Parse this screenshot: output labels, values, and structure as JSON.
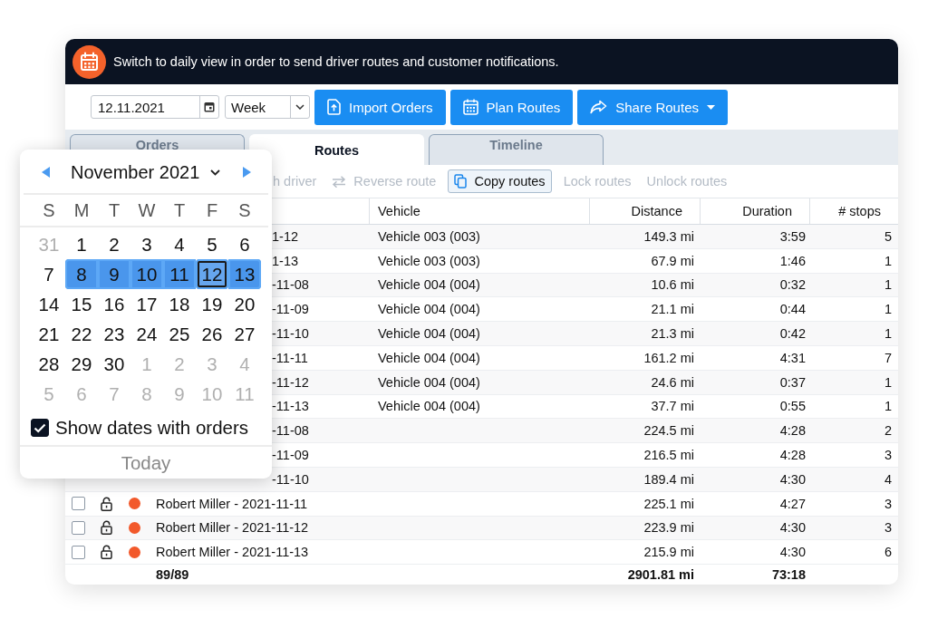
{
  "banner": {
    "text": "Switch to daily view in order to send driver routes and customer notifications."
  },
  "toolbar": {
    "date": "12.11.2021",
    "view": "Week",
    "buttons": [
      {
        "label": "Import Orders",
        "kind": "import"
      },
      {
        "label": "Plan Routes",
        "kind": "plan"
      },
      {
        "label": "Share Routes",
        "kind": "share"
      }
    ]
  },
  "tabs": [
    {
      "label": "Orders",
      "selected": false
    },
    {
      "label": "Routes",
      "selected": true
    },
    {
      "label": "Timeline",
      "selected": false
    }
  ],
  "actions": [
    {
      "label": "h driver",
      "kind": "plain",
      "disabled": true
    },
    {
      "label": "Reverse route",
      "kind": "reverse",
      "disabled": true
    },
    {
      "label": "Copy routes",
      "kind": "copy",
      "disabled": false
    },
    {
      "label": "Lock routes",
      "kind": "plain",
      "disabled": true
    },
    {
      "label": "Unlock routes",
      "kind": "plain",
      "disabled": true
    }
  ],
  "table": {
    "columns": [
      "Vehicle",
      "Distance",
      "Duration",
      "# stops"
    ],
    "rows": [
      {
        "route": "1-12",
        "vehicle": "Vehicle 003 (003)",
        "distance": "149.3 mi",
        "duration": "3:59",
        "stops": "5"
      },
      {
        "route": "1-13",
        "vehicle": "Vehicle 003 (003)",
        "distance": "67.9 mi",
        "duration": "1:46",
        "stops": "1"
      },
      {
        "route": "-11-08",
        "vehicle": "Vehicle 004 (004)",
        "distance": "10.6 mi",
        "duration": "0:32",
        "stops": "1"
      },
      {
        "route": "-11-09",
        "vehicle": "Vehicle 004 (004)",
        "distance": "21.1 mi",
        "duration": "0:44",
        "stops": "1"
      },
      {
        "route": "-11-10",
        "vehicle": "Vehicle 004 (004)",
        "distance": "21.3 mi",
        "duration": "0:42",
        "stops": "1"
      },
      {
        "route": "-11-11",
        "vehicle": "Vehicle 004 (004)",
        "distance": "161.2 mi",
        "duration": "4:31",
        "stops": "7"
      },
      {
        "route": "-11-12",
        "vehicle": "Vehicle 004 (004)",
        "distance": "24.6 mi",
        "duration": "0:37",
        "stops": "1"
      },
      {
        "route": "-11-13",
        "vehicle": "Vehicle 004 (004)",
        "distance": "37.7 mi",
        "duration": "0:55",
        "stops": "1"
      },
      {
        "route": "-11-08",
        "distance": "224.5 mi",
        "duration": "4:28",
        "stops": "2"
      },
      {
        "route": "-11-09",
        "distance": "216.5 mi",
        "duration": "4:28",
        "stops": "3"
      },
      {
        "route": "-11-10",
        "distance": "189.4 mi",
        "duration": "4:30",
        "stops": "4"
      },
      {
        "checked": false,
        "locked": false,
        "color": "#f2592b",
        "route": "Robert Miller - 2021-11-11",
        "distance": "225.1 mi",
        "duration": "4:27",
        "stops": "3"
      },
      {
        "checked": false,
        "locked": false,
        "color": "#f2592b",
        "route": "Robert Miller - 2021-11-12",
        "distance": "223.9 mi",
        "duration": "4:30",
        "stops": "3"
      },
      {
        "checked": false,
        "locked": false,
        "color": "#f2592b",
        "route": "Robert Miller - 2021-11-13",
        "distance": "215.9 mi",
        "duration": "4:30",
        "stops": "6"
      }
    ],
    "footer": {
      "count": "89/89",
      "distance": "2901.81 mi",
      "duration": "73:18"
    }
  },
  "calendar": {
    "month": "November 2021",
    "weekdays": [
      "S",
      "M",
      "T",
      "W",
      "T",
      "F",
      "S"
    ],
    "days": [
      {
        "label": "31",
        "outside": true,
        "in_range": false,
        "selected": false
      },
      {
        "label": "1",
        "outside": false,
        "in_range": false,
        "selected": false
      },
      {
        "label": "2",
        "outside": false,
        "in_range": false,
        "selected": false
      },
      {
        "label": "3",
        "outside": false,
        "in_range": false,
        "selected": false
      },
      {
        "label": "4",
        "outside": false,
        "in_range": false,
        "selected": false
      },
      {
        "label": "5",
        "outside": false,
        "in_range": false,
        "selected": false
      },
      {
        "label": "6",
        "outside": false,
        "in_range": false,
        "selected": false
      },
      {
        "label": "7",
        "outside": false,
        "in_range": false,
        "selected": false
      },
      {
        "label": "8",
        "outside": false,
        "in_range": true,
        "selected": false
      },
      {
        "label": "9",
        "outside": false,
        "in_range": true,
        "selected": false
      },
      {
        "label": "10",
        "outside": false,
        "in_range": true,
        "selected": false
      },
      {
        "label": "11",
        "outside": false,
        "in_range": true,
        "selected": false
      },
      {
        "label": "12",
        "outside": false,
        "in_range": true,
        "selected": true
      },
      {
        "label": "13",
        "outside": false,
        "in_range": true,
        "selected": false
      },
      {
        "label": "14",
        "outside": false,
        "in_range": false,
        "selected": false
      },
      {
        "label": "15",
        "outside": false,
        "in_range": false,
        "selected": false
      },
      {
        "label": "16",
        "outside": false,
        "in_range": false,
        "selected": false
      },
      {
        "label": "17",
        "outside": false,
        "in_range": false,
        "selected": false
      },
      {
        "label": "18",
        "outside": false,
        "in_range": false,
        "selected": false
      },
      {
        "label": "19",
        "outside": false,
        "in_range": false,
        "selected": false
      },
      {
        "label": "20",
        "outside": false,
        "in_range": false,
        "selected": false
      },
      {
        "label": "21",
        "outside": false,
        "in_range": false,
        "selected": false
      },
      {
        "label": "22",
        "outside": false,
        "in_range": false,
        "selected": false
      },
      {
        "label": "23",
        "outside": false,
        "in_range": false,
        "selected": false
      },
      {
        "label": "24",
        "outside": false,
        "in_range": false,
        "selected": false
      },
      {
        "label": "25",
        "outside": false,
        "in_range": false,
        "selected": false
      },
      {
        "label": "26",
        "outside": false,
        "in_range": false,
        "selected": false
      },
      {
        "label": "27",
        "outside": false,
        "in_range": false,
        "selected": false
      },
      {
        "label": "28",
        "outside": false,
        "in_range": false,
        "selected": false
      },
      {
        "label": "29",
        "outside": false,
        "in_range": false,
        "selected": false
      },
      {
        "label": "30",
        "outside": false,
        "in_range": false,
        "selected": false
      },
      {
        "label": "1",
        "outside": true,
        "in_range": false,
        "selected": false
      },
      {
        "label": "2",
        "outside": true,
        "in_range": false,
        "selected": false
      },
      {
        "label": "3",
        "outside": true,
        "in_range": false,
        "selected": false
      },
      {
        "label": "4",
        "outside": true,
        "in_range": false,
        "selected": false
      },
      {
        "label": "5",
        "outside": true,
        "in_range": false,
        "selected": false
      },
      {
        "label": "6",
        "outside": true,
        "in_range": false,
        "selected": false
      },
      {
        "label": "7",
        "outside": true,
        "in_range": false,
        "selected": false
      },
      {
        "label": "8",
        "outside": true,
        "in_range": false,
        "selected": false
      },
      {
        "label": "9",
        "outside": true,
        "in_range": false,
        "selected": false
      },
      {
        "label": "10",
        "outside": true,
        "in_range": false,
        "selected": false
      },
      {
        "label": "11",
        "outside": true,
        "in_range": false,
        "selected": false
      }
    ],
    "show_dates": {
      "label": "Show dates with orders",
      "checked": true
    },
    "today": "Today"
  }
}
